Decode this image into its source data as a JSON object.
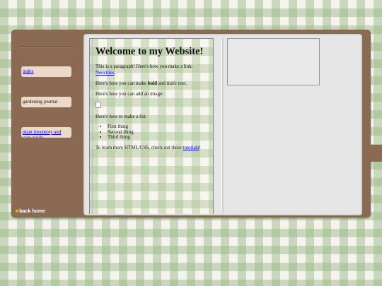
{
  "sidebar": {
    "items": [
      {
        "label": "index",
        "is_link": true
      },
      {
        "label": "gardening journal",
        "is_link": false
      },
      {
        "label": "plant inventory and care guide",
        "is_link": true
      }
    ],
    "back_home": {
      "icon": "star-icon",
      "label": "back home"
    }
  },
  "content": {
    "heading": "Welcome to my Website!",
    "p1_before": "This is a paragraph! Here's how you make a link: ",
    "p1_link": "Neocities",
    "p1_after": ".",
    "p2_before": "Here's how you can make ",
    "p2_bold": "bold",
    "p2_mid": " and ",
    "p2_italic": "italic",
    "p2_after": " text.",
    "p3": "Here's how you can add an image:",
    "p4": "Here's how to make a list:",
    "list": [
      "First thing",
      "Second thing",
      "Third thing"
    ],
    "p5_before": "To learn more HTML/CSS, check out these ",
    "p5_link": "tutorials",
    "p5_after": "!"
  },
  "colors": {
    "frame_brown": "#8a6a52",
    "nav_item_bg": "#ecd9c8",
    "gingham_green": "#96b482",
    "link": "#0000ee",
    "star": "#f5c400"
  }
}
